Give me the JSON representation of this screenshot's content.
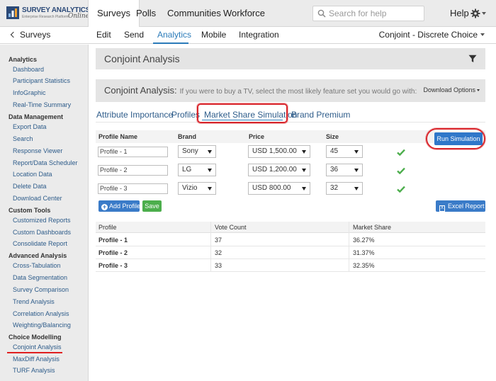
{
  "logo": {
    "brand": "SURVEY ANALYTICS",
    "tagline": "Enterprise Research Platform",
    "script": "Online"
  },
  "topnav": {
    "items": [
      "Surveys",
      "Polls",
      "Communities",
      "Workforce"
    ],
    "active": "Surveys"
  },
  "search": {
    "placeholder": "Search for help"
  },
  "help_label": "Help",
  "subnav": {
    "back_label": "Surveys",
    "items": [
      "Edit",
      "Send",
      "Analytics",
      "Mobile",
      "Integration"
    ],
    "active": "Analytics",
    "project": "Conjoint - Discrete Choice"
  },
  "sidebar": {
    "sections": [
      {
        "heading": "Analytics",
        "items": [
          "Dashboard",
          "Participant Statistics",
          "InfoGraphic",
          "Real-Time Summary"
        ]
      },
      {
        "heading": "Data Management",
        "items": [
          "Export Data",
          "Search",
          "Response Viewer",
          "Report/Data Scheduler",
          "Location Data",
          "Delete Data",
          "Download Center"
        ]
      },
      {
        "heading": "Custom Tools",
        "items": [
          "Customized Reports",
          "Custom Dashboards",
          "Consolidate Report"
        ]
      },
      {
        "heading": "Advanced Analysis",
        "items": [
          "Cross-Tabulation",
          "Data Segmentation",
          "Survey Comparison",
          "Trend Analysis",
          "Correlation Analysis",
          "Weighting/Balancing"
        ]
      },
      {
        "heading": "Choice Modelling",
        "items": [
          "Conjoint Analysis",
          "MaxDiff Analysis",
          "TURF Analysis"
        ]
      }
    ],
    "active_item": "Conjoint Analysis"
  },
  "page": {
    "title": "Conjoint Analysis",
    "subtitle": "Conjoint Analysis:",
    "question": "If you were to buy a TV, select the most likely feature set you would go with:",
    "download_options": "Download Options"
  },
  "tabs": [
    "Attribute Importance",
    "Profiles",
    "Market Share Simulation",
    "Brand Premium"
  ],
  "active_tab": "Market Share Simulation",
  "simulation": {
    "headers": {
      "profile_name": "Profile Name",
      "brand": "Brand",
      "price": "Price",
      "size": "Size"
    },
    "rows": [
      {
        "profile": "Profile - 1",
        "brand": "Sony",
        "price": "USD 1,500.00",
        "size": "45"
      },
      {
        "profile": "Profile - 2",
        "brand": "LG",
        "price": "USD 1,200.00",
        "size": "36"
      },
      {
        "profile": "Profile - 3",
        "brand": "Vizio",
        "price": "USD 800.00",
        "size": "32"
      }
    ],
    "run_label": "Run Simulation",
    "add_profile_label": "Add Profile",
    "save_label": "Save",
    "excel_label": "Excel Report"
  },
  "results": {
    "headers": {
      "profile": "Profile",
      "vote_count": "Vote Count",
      "market_share": "Market Share"
    },
    "rows": [
      {
        "profile": "Profile - 1",
        "vote_count": "37",
        "market_share": "36.27%"
      },
      {
        "profile": "Profile - 2",
        "vote_count": "32",
        "market_share": "31.37%"
      },
      {
        "profile": "Profile - 3",
        "vote_count": "33",
        "market_share": "32.35%"
      }
    ]
  },
  "colors": {
    "accent": "#2b7bb9",
    "highlight": "#d9262c",
    "success": "#4cae4c"
  }
}
